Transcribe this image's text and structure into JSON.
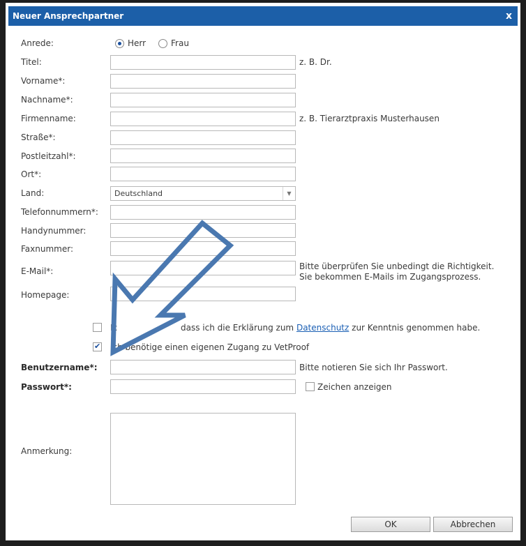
{
  "dialog": {
    "title": "Neuer Ansprechpartner",
    "close": "x"
  },
  "form": {
    "anrede": {
      "label": "Anrede:",
      "options": [
        "Herr",
        "Frau"
      ],
      "selected": "Herr"
    },
    "titel": {
      "label": "Titel:",
      "value": "",
      "hint": "z. B. Dr."
    },
    "vorname": {
      "label": "Vorname*:",
      "value": ""
    },
    "nachname": {
      "label": "Nachname*:",
      "value": ""
    },
    "firmenname": {
      "label": "Firmenname:",
      "value": "",
      "hint": "z. B. Tierarztpraxis Musterhausen"
    },
    "strasse": {
      "label": "Straße*:",
      "value": ""
    },
    "plz": {
      "label": "Postleitzahl*:",
      "value": ""
    },
    "ort": {
      "label": "Ort*:",
      "value": ""
    },
    "land": {
      "label": "Land:",
      "value": "Deutschland"
    },
    "telefon": {
      "label": "Telefonnummern*:",
      "value": ""
    },
    "handy": {
      "label": "Handynummer:",
      "value": ""
    },
    "fax": {
      "label": "Faxnummer:",
      "value": ""
    },
    "email": {
      "label": "E-Mail*:",
      "value": "",
      "hint_line1": "Bitte überprüfen Sie unbedingt die Richtigkeit.",
      "hint_line2": "Sie bekommen E-Mails im Zugangsprozess."
    },
    "homepage": {
      "label": "Homepage:",
      "value": ""
    },
    "datenschutz": {
      "checked": false,
      "text_pre": "Ic",
      "text_mid": "dass ich die Erklärung zum",
      "link": "Datenschutz",
      "text_post": "zur Kenntnis genommen habe."
    },
    "zugang": {
      "checked": true,
      "text": "Ich benötige einen eigenen Zugang zu VetProof"
    },
    "benutzername": {
      "label": "Benutzername*:",
      "value": "",
      "hint": "Bitte notieren Sie sich Ihr Passwort."
    },
    "passwort": {
      "label": "Passwort*:",
      "value": "",
      "show_label": "Zeichen anzeigen",
      "show_checked": false
    },
    "anmerkung": {
      "label": "Anmerkung:",
      "value": ""
    }
  },
  "buttons": {
    "ok": "OK",
    "cancel": "Abbrechen"
  },
  "colors": {
    "titlebar": "#1c5fa8",
    "arrow_stroke": "#4a78b0"
  }
}
